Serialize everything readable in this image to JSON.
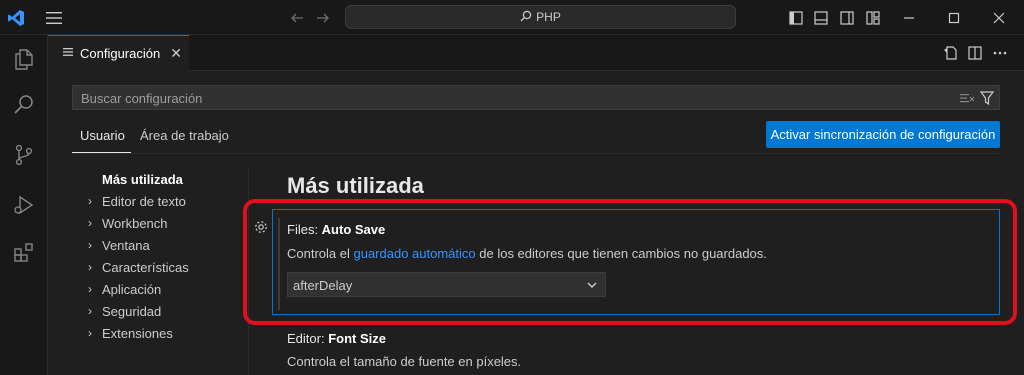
{
  "titlebar": {
    "command_center": "PHP",
    "colors": {
      "vscode_blue": "#3794ff"
    }
  },
  "tabs": [
    {
      "label": "Configuración"
    }
  ],
  "search": {
    "placeholder": "Buscar configuración"
  },
  "scope_tabs": {
    "user": "Usuario",
    "workspace": "Área de trabajo"
  },
  "sync_button": "Activar sincronización de configuración",
  "toc": {
    "active": "Más utilizada",
    "items": [
      "Editor de texto",
      "Workbench",
      "Ventana",
      "Características",
      "Aplicación",
      "Seguridad",
      "Extensiones"
    ]
  },
  "main": {
    "section_title": "Más utilizada",
    "autosave": {
      "category": "Files: ",
      "name": "Auto Save",
      "desc_before": "Controla el ",
      "desc_link": "guardado automático",
      "desc_after": " de los editores que tienen cambios no guardados.",
      "value": "afterDelay"
    },
    "fontsize": {
      "category": "Editor: ",
      "name": "Font Size",
      "desc": "Controla el tamaño de fuente en píxeles."
    }
  },
  "colors": {
    "accent": "#0078d4",
    "highlight": "#e0101e"
  }
}
